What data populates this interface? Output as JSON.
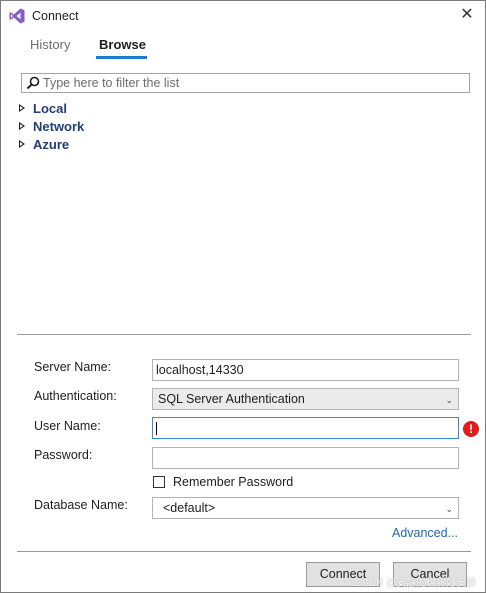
{
  "window": {
    "title": "Connect",
    "close_glyph": "✕"
  },
  "tabs": [
    {
      "label": "History",
      "active": false
    },
    {
      "label": "Browse",
      "active": true
    }
  ],
  "filter": {
    "placeholder": "Type here to filter the list",
    "value": ""
  },
  "tree": {
    "items": [
      {
        "label": "Local",
        "icon": "expand-arrow-icon"
      },
      {
        "label": "Network",
        "icon": "expand-arrow-icon"
      },
      {
        "label": "Azure",
        "icon": "expand-arrow-icon"
      }
    ]
  },
  "form": {
    "server_name_label": "Server Name:",
    "server_name_value": "localhost,14330",
    "authentication_label": "Authentication:",
    "authentication_value": "SQL Server Authentication",
    "user_name_label": "User Name:",
    "user_name_value": "",
    "user_name_error_glyph": "!",
    "password_label": "Password:",
    "password_value": "",
    "remember_password_label": "Remember Password",
    "remember_password_checked": false,
    "database_name_label": "Database Name:",
    "database_name_value": "<default>",
    "advanced_link": "Advanced..."
  },
  "buttons": {
    "connect": "Connect",
    "cancel": "Cancel"
  },
  "watermark": "CSDN @安静的世界好安静",
  "colors": {
    "accent": "#1e7bd1",
    "tree_text": "#1f3d78",
    "link": "#1e66b8",
    "error": "#e41b1b",
    "vs_purple": "#865fc5"
  }
}
